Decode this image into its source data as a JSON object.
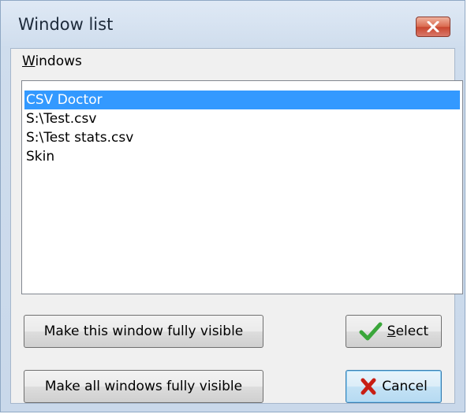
{
  "window": {
    "title": "Window list",
    "close_icon": "close-icon"
  },
  "windows_group": {
    "label_accel": "W",
    "label_rest": "indows"
  },
  "list": {
    "items": [
      {
        "label": "CSV Doctor",
        "selected": true
      },
      {
        "label": "S:\\Test.csv",
        "selected": false
      },
      {
        "label": "S:\\Test stats.csv",
        "selected": false
      },
      {
        "label": "Skin",
        "selected": false
      }
    ]
  },
  "buttons": {
    "make_visible": "Make this window fully visible",
    "make_all_visible": "Make all windows fully visible",
    "select_accel": "S",
    "select_rest": "elect",
    "select_icon": "checkmark-icon",
    "cancel": "Cancel",
    "cancel_icon": "x-icon"
  },
  "colors": {
    "selection": "#3399ff",
    "close_button": "#c9462e",
    "check": "#3aa63a",
    "cancel_x": "#c81e14"
  }
}
